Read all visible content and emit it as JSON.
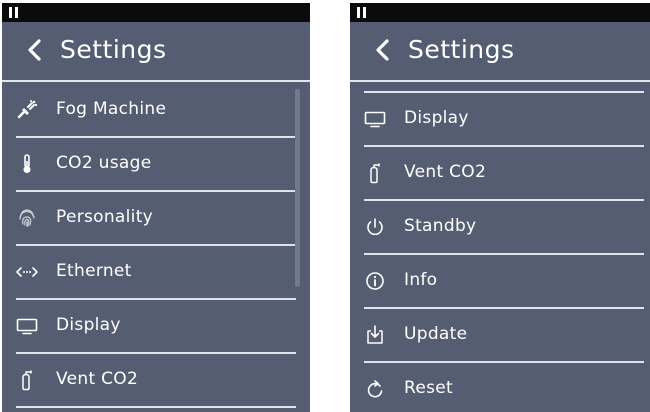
{
  "left_screen": {
    "header": {
      "title": "Settings"
    },
    "menu_items": [
      {
        "label": "Fog Machine",
        "icon": "fog-machine-icon"
      },
      {
        "label": "CO2 usage",
        "icon": "thermometer-icon"
      },
      {
        "label": "Personality",
        "icon": "fingerprint-icon"
      },
      {
        "label": "Ethernet",
        "icon": "ethernet-icon"
      },
      {
        "label": "Display",
        "icon": "display-icon"
      },
      {
        "label": "Vent CO2",
        "icon": "gas-cylinder-icon"
      }
    ]
  },
  "right_screen": {
    "header": {
      "title": "Settings"
    },
    "menu_items": [
      {
        "label": "Display",
        "icon": "display-icon"
      },
      {
        "label": "Vent CO2",
        "icon": "gas-cylinder-icon"
      },
      {
        "label": "Standby",
        "icon": "power-icon"
      },
      {
        "label": "Info",
        "icon": "info-icon"
      },
      {
        "label": "Update",
        "icon": "update-icon"
      },
      {
        "label": "Reset",
        "icon": "reset-icon"
      }
    ]
  },
  "colors": {
    "background": "#555d72",
    "status_bar": "#0b0b0b",
    "divider": "#dfe2e9",
    "text": "#ffffff",
    "scrollbar": "#727a8e"
  }
}
